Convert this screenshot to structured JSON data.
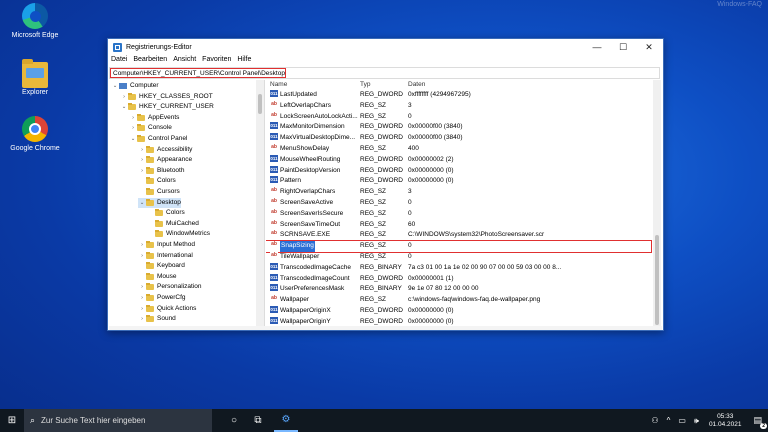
{
  "watermark": "Windows-FAQ",
  "desktop_icons": [
    {
      "label": "Microsoft Edge",
      "icon": "edge-icon"
    },
    {
      "label": "Explorer",
      "icon": "folder-icon"
    },
    {
      "label": "Google Chrome",
      "icon": "chrome-icon"
    }
  ],
  "window": {
    "title": "Registrierungs-Editor",
    "controls": {
      "minimize": "—",
      "maximize": "☐",
      "close": "✕"
    },
    "menu": [
      "Datei",
      "Bearbeiten",
      "Ansicht",
      "Favoriten",
      "Hilfe"
    ],
    "address": "Computer\\HKEY_CURRENT_USER\\Control Panel\\Desktop"
  },
  "tree": [
    {
      "label": "Computer",
      "arrow": "⌄",
      "indent": 0,
      "folder": false
    },
    {
      "label": "HKEY_CLASSES_ROOT",
      "arrow": "›",
      "indent": 1,
      "folder": true
    },
    {
      "label": "HKEY_CURRENT_USER",
      "arrow": "⌄",
      "indent": 1,
      "folder": true
    },
    {
      "label": "AppEvents",
      "arrow": "›",
      "indent": 2,
      "folder": true
    },
    {
      "label": "Console",
      "arrow": "›",
      "indent": 2,
      "folder": true
    },
    {
      "label": "Control Panel",
      "arrow": "⌄",
      "indent": 2,
      "folder": true
    },
    {
      "label": "Accessibility",
      "arrow": "›",
      "indent": 3,
      "folder": true
    },
    {
      "label": "Appearance",
      "arrow": "›",
      "indent": 3,
      "folder": true
    },
    {
      "label": "Bluetooth",
      "arrow": "›",
      "indent": 3,
      "folder": true
    },
    {
      "label": "Colors",
      "arrow": "",
      "indent": 3,
      "folder": true
    },
    {
      "label": "Cursors",
      "arrow": "",
      "indent": 3,
      "folder": true
    },
    {
      "label": "Desktop",
      "arrow": "⌄",
      "indent": 3,
      "folder": true,
      "selected": true
    },
    {
      "label": "Colors",
      "arrow": "",
      "indent": 4,
      "folder": true
    },
    {
      "label": "MuiCached",
      "arrow": "",
      "indent": 4,
      "folder": true
    },
    {
      "label": "WindowMetrics",
      "arrow": "",
      "indent": 4,
      "folder": true
    },
    {
      "label": "Input Method",
      "arrow": "›",
      "indent": 3,
      "folder": true
    },
    {
      "label": "International",
      "arrow": "›",
      "indent": 3,
      "folder": true
    },
    {
      "label": "Keyboard",
      "arrow": "",
      "indent": 3,
      "folder": true
    },
    {
      "label": "Mouse",
      "arrow": "",
      "indent": 3,
      "folder": true
    },
    {
      "label": "Personalization",
      "arrow": "›",
      "indent": 3,
      "folder": true
    },
    {
      "label": "PowerCfg",
      "arrow": "›",
      "indent": 3,
      "folder": true
    },
    {
      "label": "Quick Actions",
      "arrow": "›",
      "indent": 3,
      "folder": true
    },
    {
      "label": "Sound",
      "arrow": "›",
      "indent": 3,
      "folder": true
    }
  ],
  "list": {
    "headers": {
      "name": "Name",
      "type": "Typ",
      "data": "Daten"
    },
    "rows": [
      {
        "name": "LastUpdated",
        "type": "REG_DWORD",
        "data": "0xffffffff (4294967295)",
        "kind": "bin"
      },
      {
        "name": "LeftOverlapChars",
        "type": "REG_SZ",
        "data": "3",
        "kind": "sz"
      },
      {
        "name": "LockScreenAutoLockActi...",
        "type": "REG_SZ",
        "data": "0",
        "kind": "sz"
      },
      {
        "name": "MaxMonitorDimension",
        "type": "REG_DWORD",
        "data": "0x00000f00 (3840)",
        "kind": "bin"
      },
      {
        "name": "MaxVirtualDesktopDime...",
        "type": "REG_DWORD",
        "data": "0x00000f00 (3840)",
        "kind": "bin"
      },
      {
        "name": "MenuShowDelay",
        "type": "REG_SZ",
        "data": "400",
        "kind": "sz"
      },
      {
        "name": "MouseWheelRouting",
        "type": "REG_DWORD",
        "data": "0x00000002 (2)",
        "kind": "bin"
      },
      {
        "name": "PaintDesktopVersion",
        "type": "REG_DWORD",
        "data": "0x00000000 (0)",
        "kind": "bin"
      },
      {
        "name": "Pattern",
        "type": "REG_DWORD",
        "data": "0x00000000 (0)",
        "kind": "bin"
      },
      {
        "name": "RightOverlapChars",
        "type": "REG_SZ",
        "data": "3",
        "kind": "sz"
      },
      {
        "name": "ScreenSaveActive",
        "type": "REG_SZ",
        "data": "0",
        "kind": "sz"
      },
      {
        "name": "ScreenSaverIsSecure",
        "type": "REG_SZ",
        "data": "0",
        "kind": "sz"
      },
      {
        "name": "ScreenSaveTimeOut",
        "type": "REG_SZ",
        "data": "60",
        "kind": "sz"
      },
      {
        "name": "SCRNSAVE.EXE",
        "type": "REG_SZ",
        "data": "C:\\WINDOWS\\system32\\PhotoScreensaver.scr",
        "kind": "sz"
      },
      {
        "name": "SnapSizing",
        "type": "REG_SZ",
        "data": "0",
        "kind": "sz",
        "highlight": true
      },
      {
        "name": "TileWallpaper",
        "type": "REG_SZ",
        "data": "0",
        "kind": "sz"
      },
      {
        "name": "TranscodedImageCache",
        "type": "REG_BINARY",
        "data": "7a c3 01 00 1a 1e 02 00 90 07 00 00 59 03 00 00 8...",
        "kind": "bin"
      },
      {
        "name": "TranscodedImageCount",
        "type": "REG_DWORD",
        "data": "0x00000001 (1)",
        "kind": "bin"
      },
      {
        "name": "UserPreferencesMask",
        "type": "REG_BINARY",
        "data": "9e 1e 07 80 12 00 00 00",
        "kind": "bin"
      },
      {
        "name": "Wallpaper",
        "type": "REG_SZ",
        "data": "c:\\windows-faq\\windows-faq.de-wallpaper.png",
        "kind": "sz"
      },
      {
        "name": "WallpaperOriginX",
        "type": "REG_DWORD",
        "data": "0x00000000 (0)",
        "kind": "bin"
      },
      {
        "name": "WallpaperOriginY",
        "type": "REG_DWORD",
        "data": "0x00000000 (0)",
        "kind": "bin"
      }
    ]
  },
  "taskbar": {
    "search_placeholder": "Zur Suche Text hier eingeben",
    "time": "05:33",
    "date": "01.04.2021",
    "notification_count": "2"
  }
}
